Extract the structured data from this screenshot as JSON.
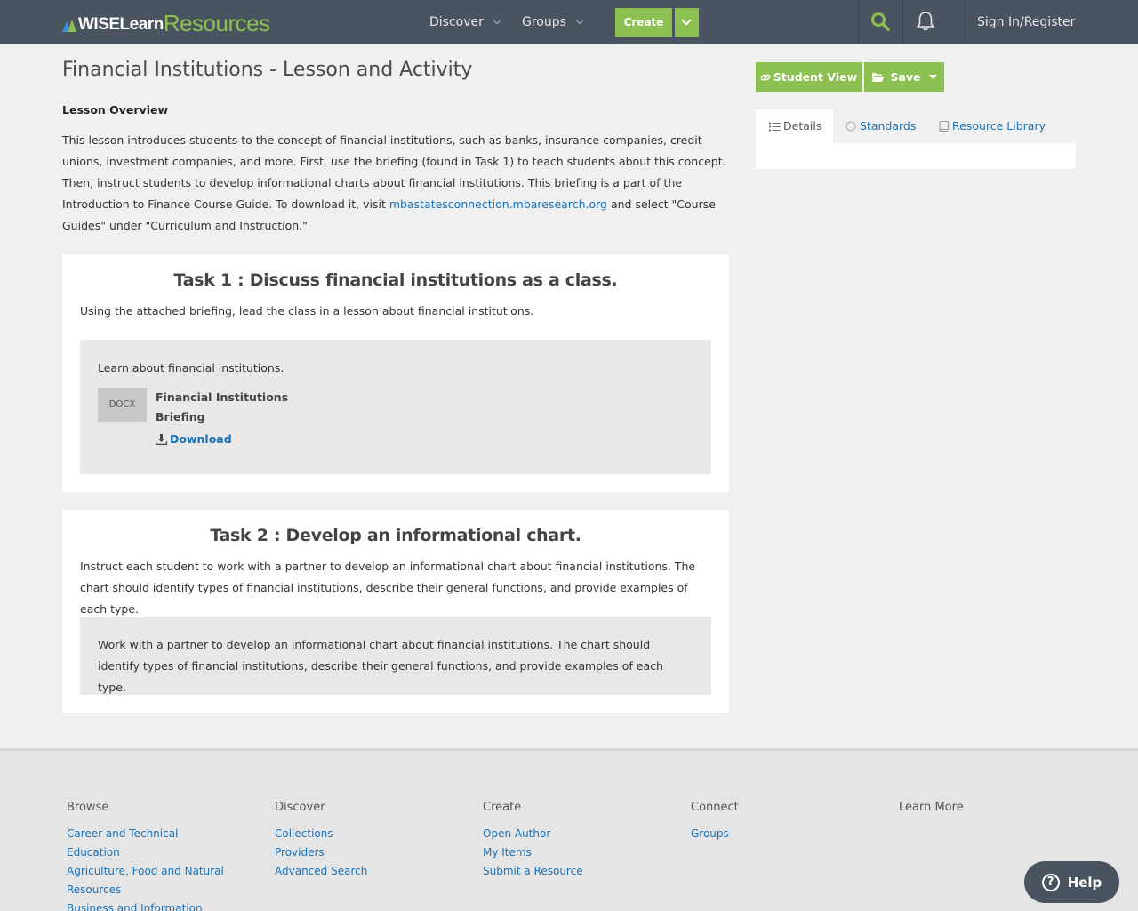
{
  "header": {
    "logo_wise": "WISELearn",
    "logo_resources": "Resources",
    "nav": [
      {
        "label": "Discover"
      },
      {
        "label": "Groups"
      }
    ],
    "create_label": "Create",
    "signin_label": "Sign In/Register"
  },
  "main": {
    "title": "Financial Institutions - Lesson and Activity",
    "overview_label": "Lesson Overview",
    "overview_text_1": "This lesson introduces students to the concept of financial institutions, such as banks, insurance companies, credit unions, investment companies, and more. First, use the briefing (found in Task 1) to teach students about this concept. Then, instruct students to develop informational charts about financial institutions. This briefing is a part of the Introduction to Finance Course Guide. To download it, visit ",
    "overview_link": "mbastatesconnection.mbaresearch.org",
    "overview_text_2": " and select \"Course Guides\" under \"Curriculum and Instruction.\"",
    "tasks": [
      {
        "title": "Task 1 : Discuss financial institutions as a class.",
        "description": "Using the attached briefing, lead the class in a lesson about financial institutions.",
        "inner_text": "Learn about financial institutions.",
        "file_type": "DOCX",
        "file_name": "Financial Institutions Briefing",
        "download_label": "Download"
      },
      {
        "title": "Task 2 : Develop an informational chart.",
        "description": "Instruct each student to work with a partner to develop an informational chart about financial institutions. The chart should identify types of financial institutions, describe their general functions, and provide examples of each type.",
        "inner_text": "Work with a partner to develop an informational chart about financial institutions. The chart should identify types of financial institutions, describe their general functions, and provide examples of each type."
      }
    ]
  },
  "sidebar": {
    "student_view_label": "Student View",
    "save_label": "Save",
    "tabs": [
      {
        "label": "Details"
      },
      {
        "label": "Standards"
      },
      {
        "label": "Resource Library"
      }
    ]
  },
  "footer": {
    "columns": [
      {
        "heading": "Browse",
        "links": [
          "Career and Technical Education",
          "Agriculture, Food and Natural Resources",
          "Business and Information Technology"
        ]
      },
      {
        "heading": "Discover",
        "links": [
          "Collections",
          "Providers",
          "Advanced Search"
        ]
      },
      {
        "heading": "Create",
        "links": [
          "Open Author",
          "My Items",
          "Submit a Resource"
        ]
      },
      {
        "heading": "Connect",
        "links": [
          "Groups"
        ]
      },
      {
        "heading": "Learn More",
        "links": []
      }
    ],
    "help_label": "Help"
  },
  "colors": {
    "header_bg": "#4a5461",
    "accent_green": "#8cc152",
    "link_blue": "#1a73b8"
  }
}
